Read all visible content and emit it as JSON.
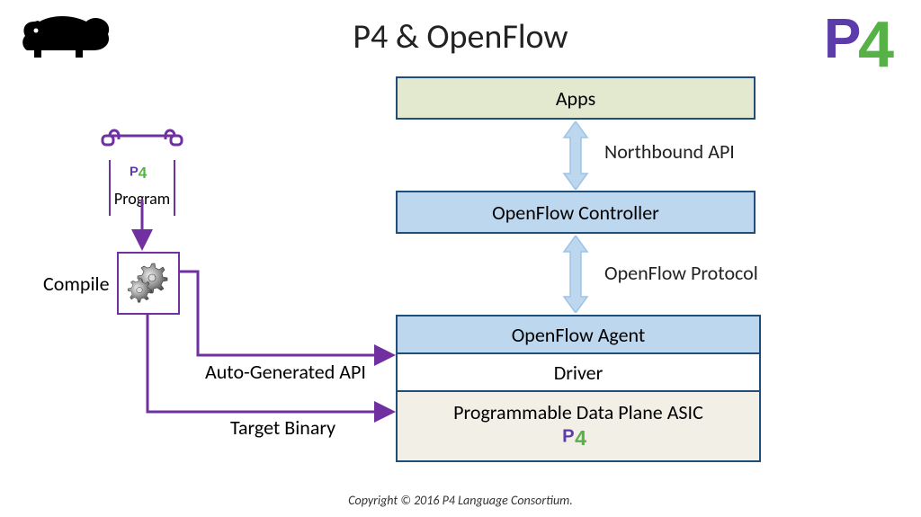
{
  "title": "P4 & OpenFlow",
  "boxes": {
    "apps": "Apps",
    "controller": "OpenFlow Controller",
    "agent": "OpenFlow Agent",
    "driver": "Driver",
    "asic": "Programmable Data Plane ASIC"
  },
  "api_labels": {
    "northbound": "Northbound API",
    "protocol": "OpenFlow Protocol"
  },
  "left": {
    "program_label": "Program",
    "compile_label": "Compile",
    "auto_api_label": "Auto-Generated API",
    "target_binary_label": "Target Binary"
  },
  "brand": {
    "p4_letter_p": "P",
    "p4_letter_4": "4"
  },
  "copyright": "Copyright © 2016 P4 Language Consortium."
}
